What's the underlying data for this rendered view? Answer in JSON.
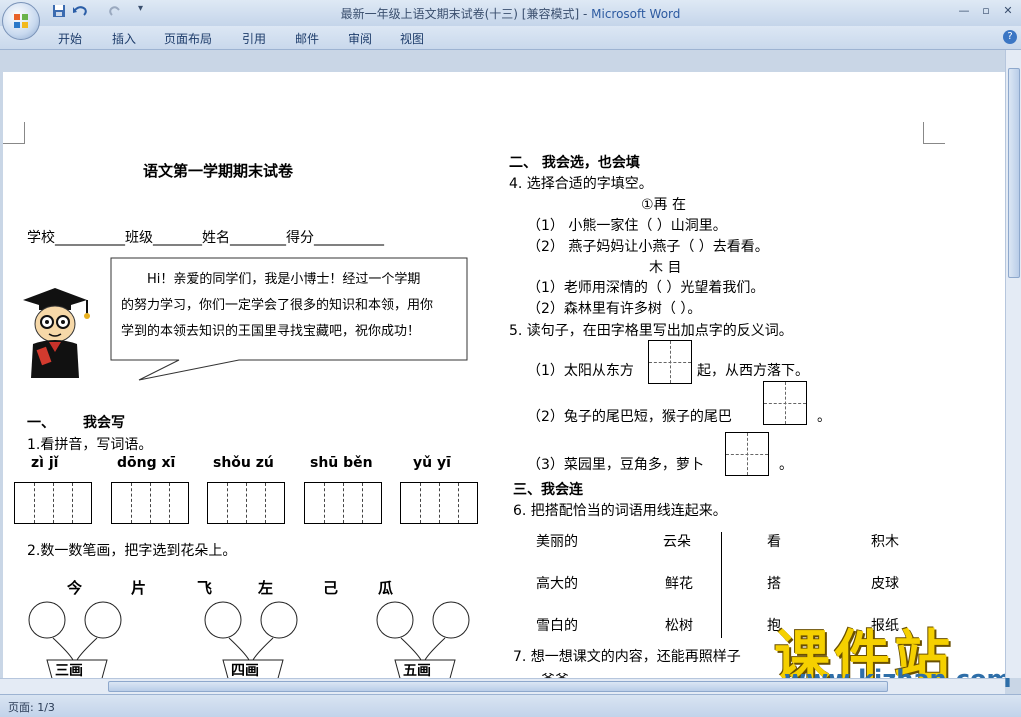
{
  "window": {
    "title": "最新一年级上语文期末试卷(十三) [兼容模式]",
    "app_name": "Microsoft Word"
  },
  "ribbon_tabs": [
    "开始",
    "插入",
    "页面布局",
    "引用",
    "邮件",
    "审阅",
    "视图"
  ],
  "status_bar": {
    "page": "页面: 1/3"
  },
  "doc": {
    "title": "语文第一学期期末试卷",
    "info_line": "学校__________班级_______姓名________得分__________",
    "speech": {
      "line1": "Hi！亲爱的同学们，我是小博士！经过一个学期",
      "line2": "的努力学习，你们一定学会了很多的知识和本领，用你",
      "line3": "学到的本领去知识的王国里寻找宝藏吧，祝你成功！"
    },
    "sec1": {
      "heading_num": "一、",
      "heading": "我会写",
      "q1": "1.看拼音，写词语。",
      "pinyin": [
        "zì  jǐ",
        "dōng  xī",
        "shǒu  zú",
        "shū  běn",
        "yǔ  yī"
      ],
      "q2": "2.数一数笔画，把字选到花朵上。",
      "chars": [
        "今",
        "片",
        "飞",
        "左",
        "己",
        "瓜"
      ],
      "pots": [
        "三画",
        "四画",
        "五画"
      ]
    },
    "sec2": {
      "heading": "二、  我会选，也会填",
      "q4": "4. 选择合适的字填空。",
      "pair1": "①再       在",
      "s1": "（1）  小熊一家住（          ）山洞里。",
      "s2": "（2）  燕子妈妈让小燕子（          ）去看看。",
      "pair2": "木        目",
      "s3": "（1）老师用深情的（      ）光望着我们。",
      "s4": "（2）森林里有许多树（     ）。",
      "q5": "5. 读句子，在田字格里写出加点字的反义词。",
      "r1a": "（1）太阳从东方",
      "r1b": "起，从西方落下。",
      "r2a": "（2）兔子的尾巴短，猴子的尾巴",
      "r2b": "。",
      "r3a": "（3）菜园里，豆角多，萝卜",
      "r3b": "。"
    },
    "sec3": {
      "heading": "三、我会连",
      "q6": "6. 把搭配恰当的词语用线连起来。",
      "col1": [
        "美丽的",
        "高大的",
        "雪白的"
      ],
      "col2": [
        "云朵",
        "鲜花",
        "松树"
      ],
      "col3": [
        "看",
        "搭",
        "抱"
      ],
      "col4": [
        "积木",
        "皮球",
        "报纸"
      ],
      "q7": "7. 想一想课文的内容，还能再照样子",
      "q7_next": "爷爷"
    },
    "watermark": {
      "brand": "课件站",
      "url": "www.kjzhan.com"
    }
  }
}
